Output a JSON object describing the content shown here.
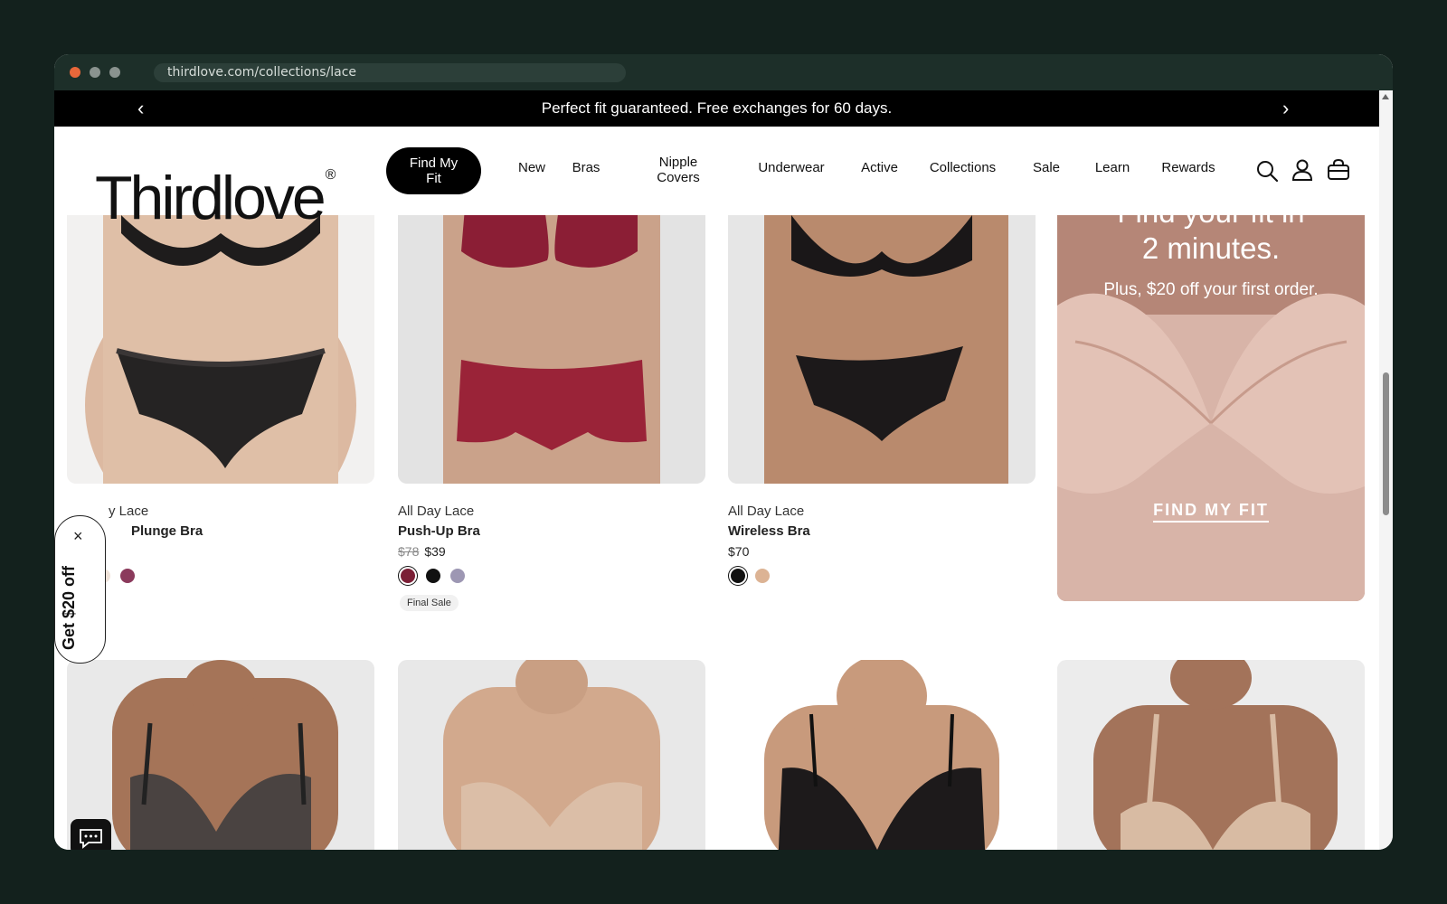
{
  "browser": {
    "url": "thirdlove.com/collections/lace"
  },
  "announcement": {
    "text": "Perfect fit guaranteed. Free exchanges for 60 days.",
    "prev_icon": "chevron-left-icon",
    "next_icon": "chevron-right-icon"
  },
  "header": {
    "logo": "Thirdlove",
    "logo_mark": "®",
    "fit_button": "Find My Fit",
    "nav": [
      "New",
      "Bras",
      "Nipple Covers",
      "Underwear",
      "Active",
      "Collections",
      "Sale",
      "Learn",
      "Rewards"
    ],
    "icons": [
      "search-icon",
      "account-icon",
      "bag-icon"
    ]
  },
  "products_row1": [
    {
      "collection": "y Lace",
      "name": "Plunge Bra",
      "swatches": [
        "#111111",
        "#efe2d8",
        "#8b3a5c"
      ],
      "selected": 0
    },
    {
      "collection": "All Day Lace",
      "name": "Push-Up Bra",
      "old_price": "$78",
      "price": "$39",
      "swatches": [
        "#7b1f36",
        "#111111",
        "#9d97b3"
      ],
      "selected": 0,
      "badge": "Final Sale"
    },
    {
      "collection": "All Day Lace",
      "name": "Wireless Bra",
      "price": "$70",
      "swatches": [
        "#111111",
        "#dcb394"
      ],
      "selected": 0
    }
  ],
  "promo": {
    "line1a": "Find your fit in",
    "line1b": "2 minutes.",
    "line2": "Plus, $20 off your first order.",
    "cta": "FIND MY FIT"
  },
  "discount_tab": {
    "label": "Get $20 off",
    "close": "×"
  },
  "colors": {
    "accent": "#000000",
    "promo_bg": "#c9a699",
    "bar": "#000000"
  }
}
